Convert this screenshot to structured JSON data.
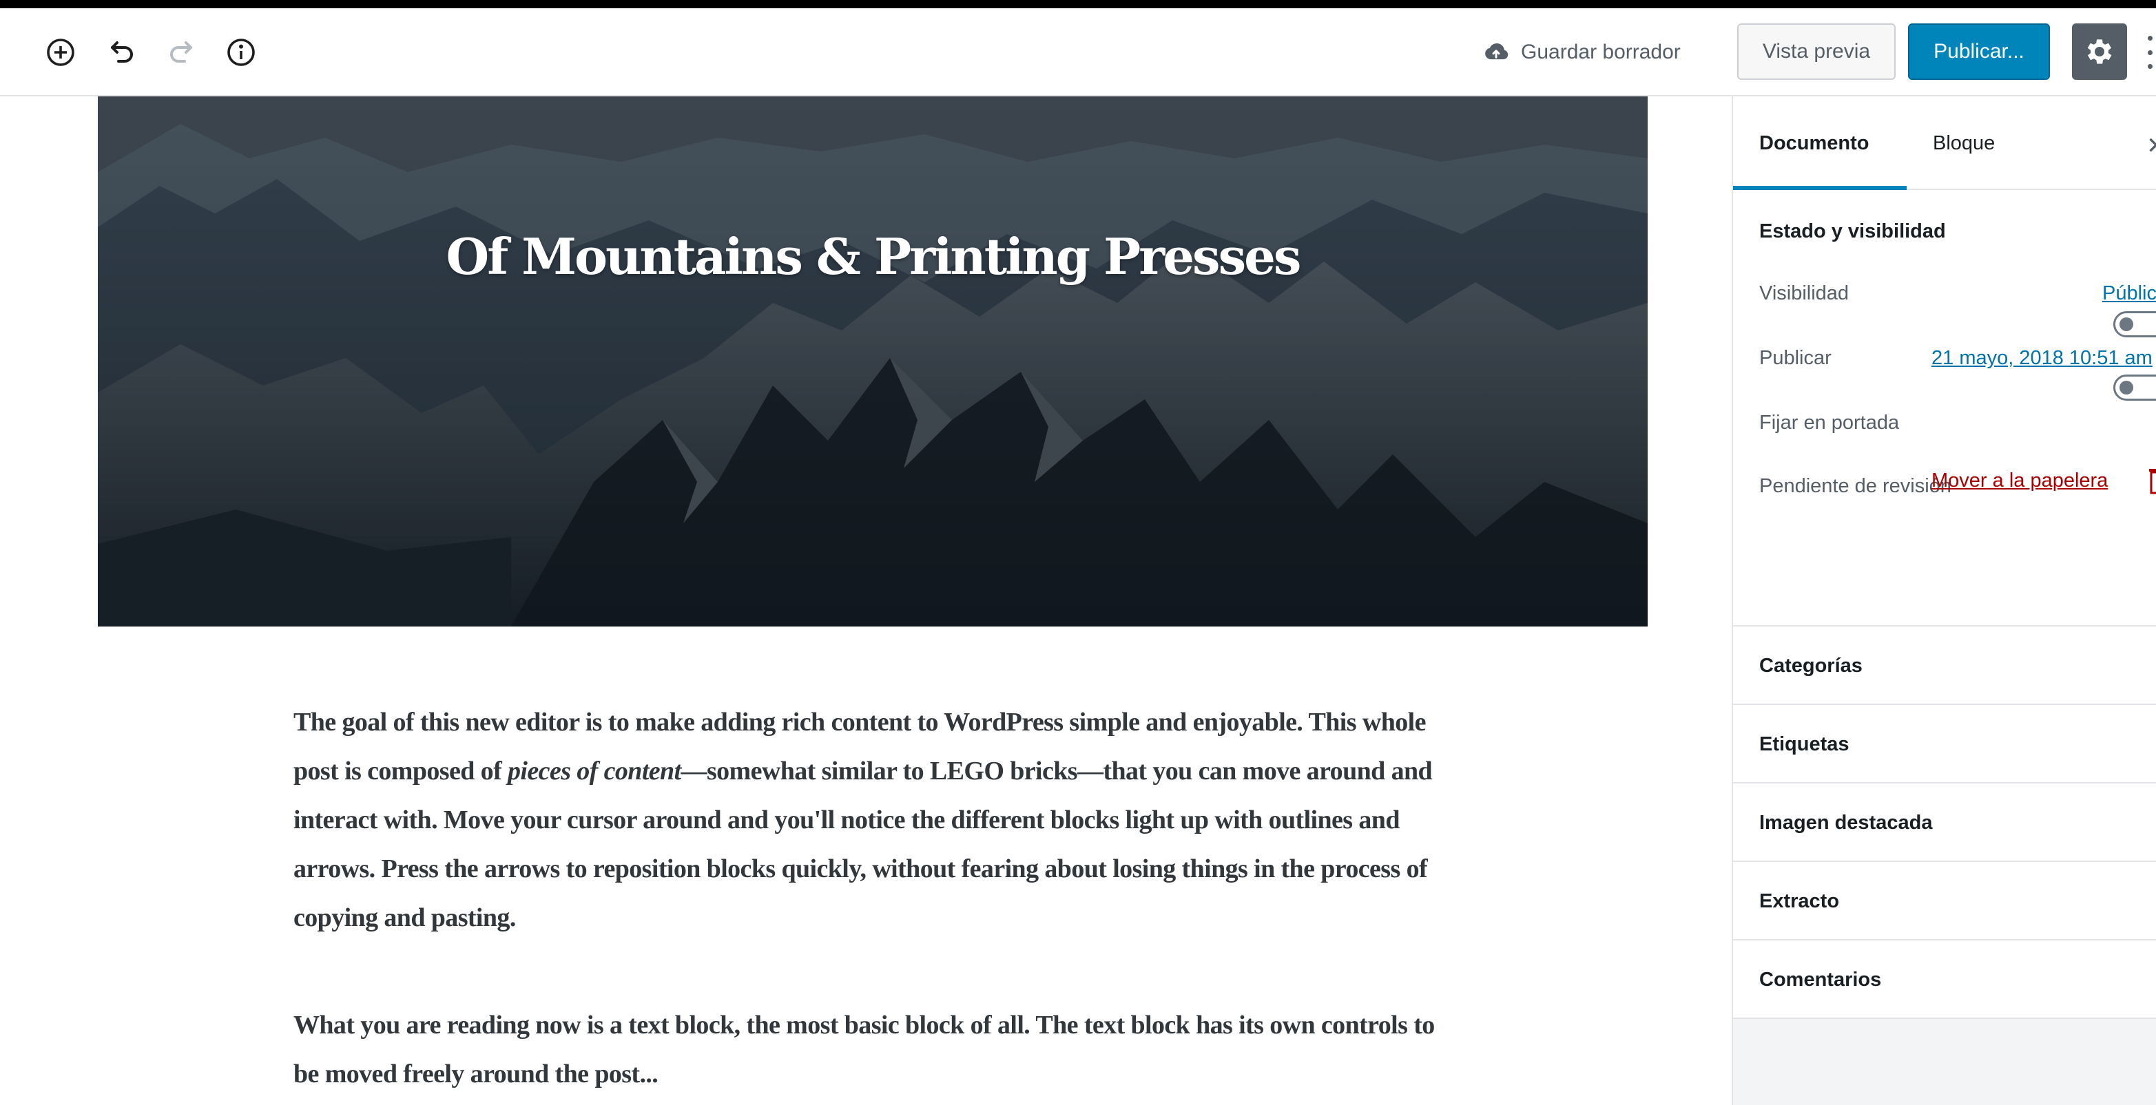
{
  "toolbar": {
    "add_icon": "plus-circle-icon",
    "undo_icon": "undo-icon",
    "redo_icon": "redo-icon",
    "info_icon": "info-icon",
    "save_draft_label": "Guardar borrador",
    "preview_label": "Vista previa",
    "publish_label": "Publicar...",
    "settings_icon": "gear-icon",
    "accent_color": "#0085ba"
  },
  "editor": {
    "cover_title": "Of Mountains & Printing Presses",
    "paragraph_1": {
      "before": "The goal of this new editor is to make adding rich content to WordPress simple and enjoyable. This whole post is composed of ",
      "emphasis": "pieces of content",
      "after": "—somewhat similar to LEGO bricks—that you can move around and interact with. Move your cursor around and you'll notice the different blocks light up with outlines and arrows. Press the arrows to reposition blocks quickly, without fearing about losing things in the process of copying and pasting."
    },
    "paragraph_2": "What you are reading now is a text block, the most basic block of all. The text block has its own controls to be moved freely around the post..."
  },
  "sidebar": {
    "tabs": [
      {
        "label": "Documento",
        "active": true
      },
      {
        "label": "Bloque",
        "active": false
      }
    ],
    "close_icon": "close-icon",
    "status": {
      "title": "Estado y visibilidad",
      "visibility_label": "Visibilidad",
      "visibility_value": "Público",
      "publish_label": "Publicar",
      "publish_value": "21 mayo, 2018 10:51 am",
      "sticky_label": "Fijar en portada",
      "pending_label": "Pendiente de revisión",
      "trash_label": "Mover a la papelera",
      "trash_color": "#a00"
    },
    "panels": [
      "Categorías",
      "Etiquetas",
      "Imagen destacada",
      "Extracto",
      "Comentarios"
    ]
  }
}
